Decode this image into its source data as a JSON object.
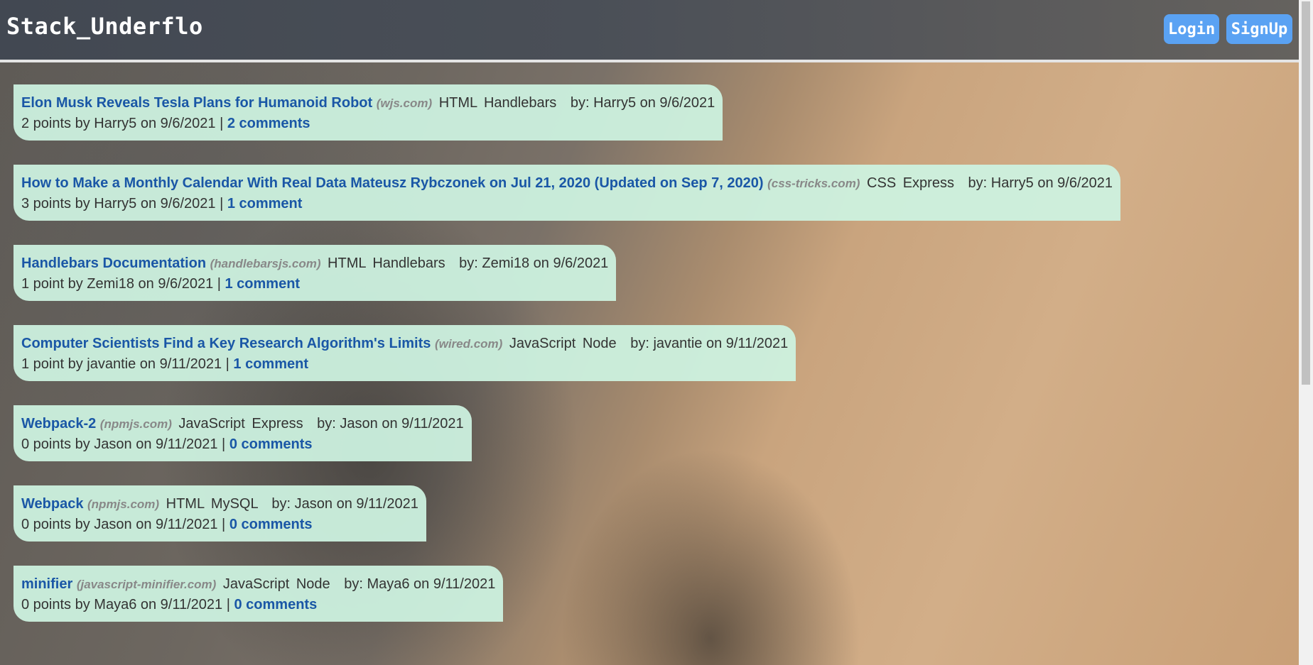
{
  "header": {
    "brand": "Stack_Underflo",
    "login_label": "Login",
    "signup_label": "SignUp"
  },
  "posts": [
    {
      "title": "Elon Musk Reveals Tesla Plans for Humanoid Robot",
      "domain": "(wjs.com)",
      "tags": [
        "HTML",
        "Handlebars"
      ],
      "byline": "by: Harry5 on 9/6/2021",
      "meta": "2 points by Harry5 on 9/6/2021 |",
      "comments": "2 comments"
    },
    {
      "title": "How to Make a Monthly Calendar With Real Data Mateusz Rybczonek on Jul 21, 2020 (Updated on Sep 7, 2020)",
      "domain": "(css-tricks.com)",
      "tags": [
        "CSS",
        "Express"
      ],
      "byline": "by: Harry5 on 9/6/2021",
      "meta": "3 points by Harry5 on 9/6/2021 |",
      "comments": "1 comment"
    },
    {
      "title": "Handlebars Documentation",
      "domain": "(handlebarsjs.com)",
      "tags": [
        "HTML",
        "Handlebars"
      ],
      "byline": "by: Zemi18 on 9/6/2021",
      "meta": "1 point by Zemi18 on 9/6/2021 |",
      "comments": "1 comment"
    },
    {
      "title": "Computer Scientists Find a Key Research Algorithm's Limits",
      "domain": "(wired.com)",
      "tags": [
        "JavaScript",
        "Node"
      ],
      "byline": "by: javantie on 9/11/2021",
      "meta": "1 point by javantie on 9/11/2021 |",
      "comments": "1 comment"
    },
    {
      "title": "Webpack-2",
      "domain": "(npmjs.com)",
      "tags": [
        "JavaScript",
        "Express"
      ],
      "byline": "by: Jason on 9/11/2021",
      "meta": "0 points by Jason on 9/11/2021 |",
      "comments": "0 comments"
    },
    {
      "title": "Webpack",
      "domain": "(npmjs.com)",
      "tags": [
        "HTML",
        "MySQL"
      ],
      "byline": "by: Jason on 9/11/2021",
      "meta": "0 points by Jason on 9/11/2021 |",
      "comments": "0 comments"
    },
    {
      "title": "minifier",
      "domain": "(javascript-minifier.com)",
      "tags": [
        "JavaScript",
        "Node"
      ],
      "byline": "by: Maya6 on 9/11/2021",
      "meta": "0 points by Maya6 on 9/11/2021 |",
      "comments": "0 comments"
    }
  ]
}
